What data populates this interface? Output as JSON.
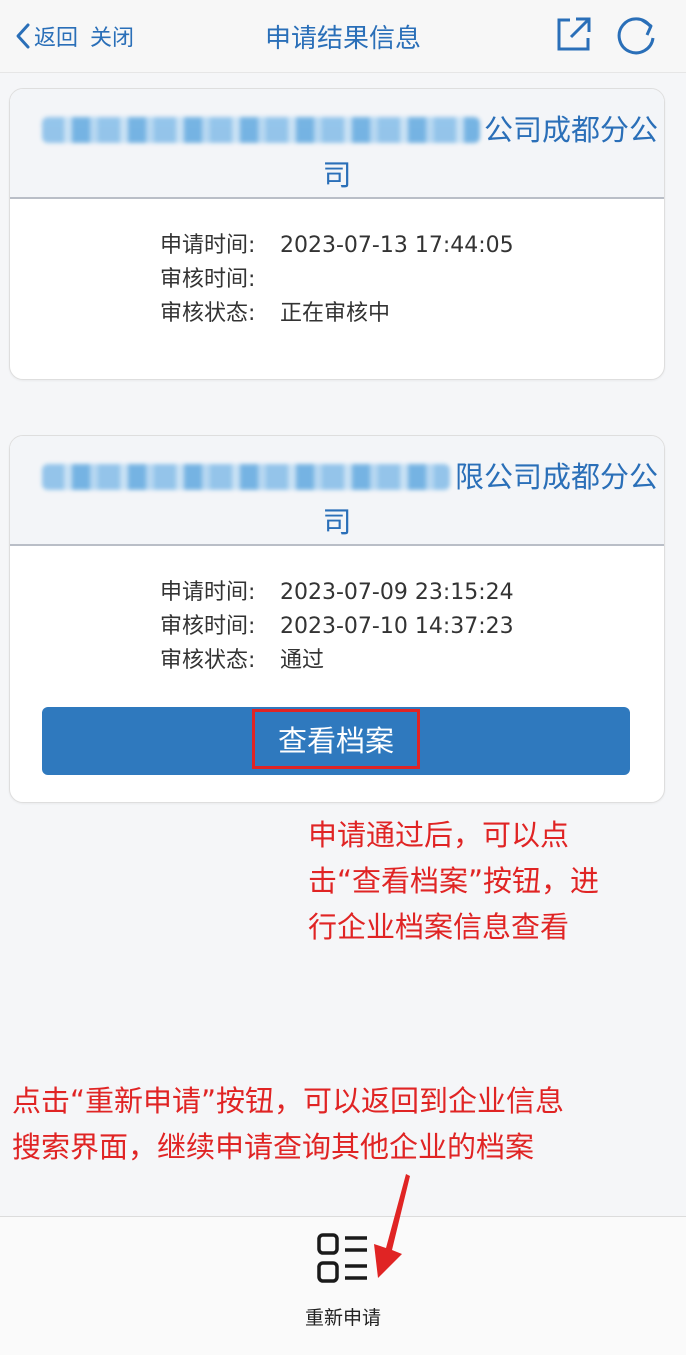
{
  "nav": {
    "back_label": "返回",
    "close_label": "关闭",
    "title": "申请结果信息"
  },
  "records": [
    {
      "company_suffix": "公司成都分公",
      "company_line2": "司",
      "apply_time_label": "申请时间:",
      "apply_time": "2023-07-13 17:44:05",
      "review_time_label": "审核时间:",
      "review_time": "",
      "status_label": "审核状态:",
      "status": "正在审核中"
    },
    {
      "company_suffix": "限公司成都分公",
      "company_line2": "司",
      "apply_time_label": "申请时间:",
      "apply_time": "2023-07-09 23:15:24",
      "review_time_label": "审核时间:",
      "review_time": "2023-07-10 14:37:23",
      "status_label": "审核状态:",
      "status": "通过",
      "button_label": "查看档案"
    }
  ],
  "annotations": {
    "archive_note_lines": [
      "申请通过后，可以点",
      "击“查看档案”按钮，进",
      "行企业档案信息查看"
    ],
    "reapply_note_lines": [
      "点击“重新申请”按钮，可以返回到企业信息",
      "搜索界面，继续申请查询其他企业的档案"
    ]
  },
  "bottom": {
    "reapply_label": "重新申请"
  },
  "colors": {
    "accent": "#2a6fb8",
    "button": "#2f79be",
    "annotation": "#e02424"
  }
}
